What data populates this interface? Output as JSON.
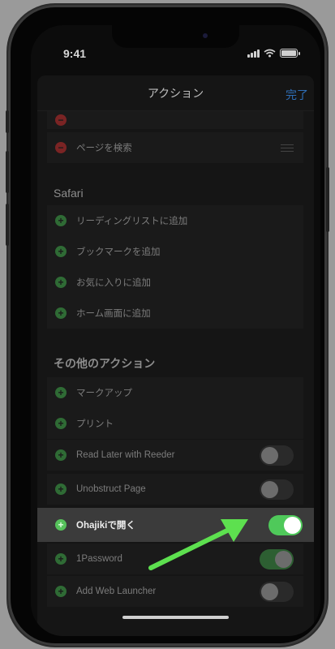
{
  "status_bar": {
    "time": "9:41"
  },
  "nav": {
    "title": "アクション",
    "done": "完了"
  },
  "top_rows": [
    {
      "label": "",
      "icon": "remove-circle-icon"
    },
    {
      "label": "ページを検索",
      "icon": "remove-circle-icon"
    }
  ],
  "sections": {
    "safari": {
      "title": "Safari",
      "items": [
        {
          "label": "リーディングリストに追加"
        },
        {
          "label": "ブックマークを追加"
        },
        {
          "label": "お気に入りに追加"
        },
        {
          "label": "ホーム画面に追加"
        }
      ]
    },
    "other": {
      "title": "その他のアクション",
      "items": [
        {
          "label": "マークアップ"
        },
        {
          "label": "プリント"
        },
        {
          "label": "Read Later with Reeder",
          "toggle": false
        },
        {
          "label": "Unobstruct Page",
          "toggle": false
        },
        {
          "label": "Ohajikiで開く",
          "toggle": true,
          "highlighted": true
        },
        {
          "label": "1Password",
          "toggle": true
        },
        {
          "label": "Add Web Launcher",
          "toggle": false
        }
      ]
    }
  },
  "colors": {
    "highlight_toggle": "#4fc95a",
    "annotation_arrow": "#5de04f",
    "done_link": "#2f6fb8"
  }
}
